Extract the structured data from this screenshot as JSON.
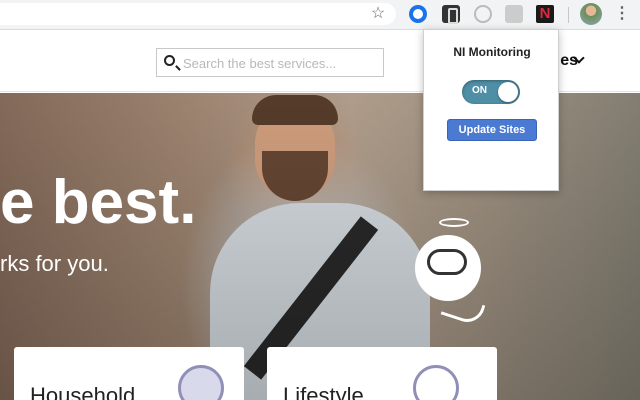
{
  "browser": {
    "extensions": [
      "blue-circle-extension-icon",
      "dark-extension-icon",
      "grey-extension-icon",
      "grey-square-extension-icon",
      "ni-monitoring-extension-icon"
    ],
    "ni_icon_text": "N"
  },
  "site": {
    "search_placeholder": "Search the best services...",
    "nav_services_label": "es",
    "hero_title": "e best.",
    "hero_subtitle": "rks for you.",
    "cards": [
      {
        "label": "Household"
      },
      {
        "label": "Lifestyle"
      }
    ]
  },
  "popup": {
    "title": "NI Monitoring",
    "toggle_label": "ON",
    "toggle_state": "on",
    "update_button_label": "Update Sites",
    "toggle_color": "#4f8fa6",
    "button_color": "#4a7ad1"
  }
}
